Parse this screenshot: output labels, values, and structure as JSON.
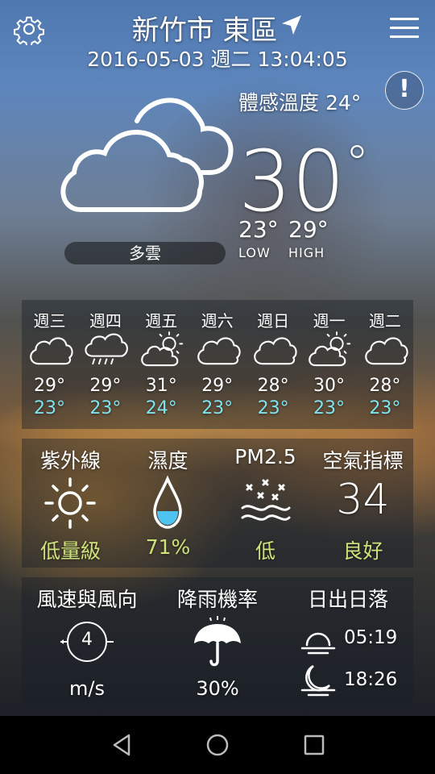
{
  "header": {
    "city": "新竹市 東區",
    "datetime": "2016-05-03 週二 13:04:05"
  },
  "current": {
    "feels_like": "體感溫度 24°",
    "temp": "30",
    "temp_unit": "°",
    "low": "23°",
    "high": "29°",
    "low_label": "LOW",
    "high_label": "HIGH",
    "condition": "多雲",
    "alert_symbol": "!"
  },
  "forecast": [
    {
      "day": "週三",
      "icon": "cloudy-icon",
      "high": "29°",
      "low": "23°"
    },
    {
      "day": "週四",
      "icon": "rain-cloud-icon",
      "high": "29°",
      "low": "23°"
    },
    {
      "day": "週五",
      "icon": "partly-sunny-icon",
      "high": "31°",
      "low": "24°"
    },
    {
      "day": "週六",
      "icon": "cloudy-icon",
      "high": "29°",
      "low": "23°"
    },
    {
      "day": "週日",
      "icon": "cloudy-icon",
      "high": "28°",
      "low": "23°"
    },
    {
      "day": "週一",
      "icon": "partly-sunny-icon",
      "high": "30°",
      "low": "23°"
    },
    {
      "day": "週二",
      "icon": "cloudy-icon",
      "high": "28°",
      "low": "23°"
    }
  ],
  "metrics": {
    "uv": {
      "title": "紫外線",
      "value": "低量級"
    },
    "humidity": {
      "title": "濕度",
      "value": "71%"
    },
    "pm25": {
      "title": "PM2.5",
      "value": "低"
    },
    "aqi": {
      "title": "空氣指標",
      "number": "34",
      "value": "良好"
    }
  },
  "wind": {
    "title": "風速與風向",
    "speed": "4",
    "unit": "m/s"
  },
  "rain": {
    "title": "降雨機率",
    "value": "30%"
  },
  "sun": {
    "title": "日出日落",
    "sunrise": "05:19",
    "sunset": "18:26"
  },
  "colors": {
    "low_temp": "#7fe3ef",
    "good_value": "#cde37a",
    "aqi_number": "#ffffff"
  }
}
